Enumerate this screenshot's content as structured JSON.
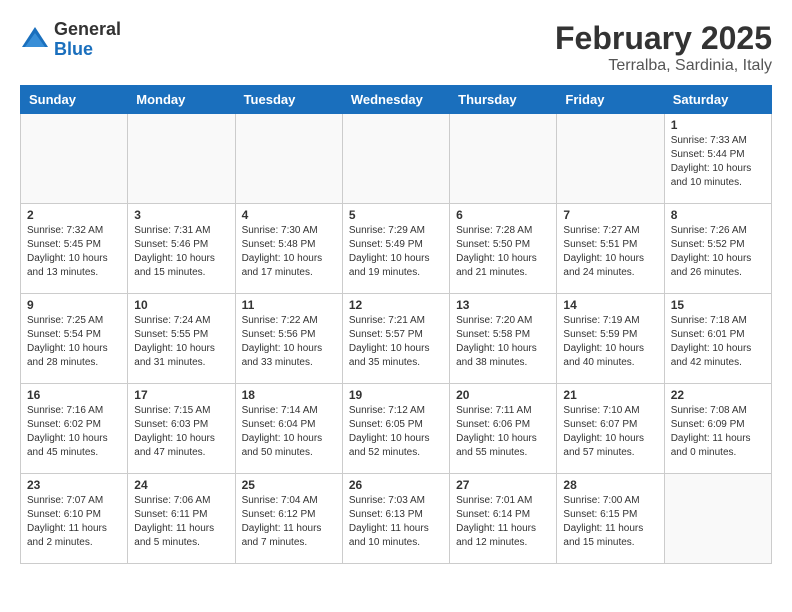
{
  "header": {
    "logo_general": "General",
    "logo_blue": "Blue",
    "title": "February 2025",
    "subtitle": "Terralba, Sardinia, Italy"
  },
  "weekdays": [
    "Sunday",
    "Monday",
    "Tuesday",
    "Wednesday",
    "Thursday",
    "Friday",
    "Saturday"
  ],
  "weeks": [
    [
      {
        "day": "",
        "info": ""
      },
      {
        "day": "",
        "info": ""
      },
      {
        "day": "",
        "info": ""
      },
      {
        "day": "",
        "info": ""
      },
      {
        "day": "",
        "info": ""
      },
      {
        "day": "",
        "info": ""
      },
      {
        "day": "1",
        "info": "Sunrise: 7:33 AM\nSunset: 5:44 PM\nDaylight: 10 hours\nand 10 minutes."
      }
    ],
    [
      {
        "day": "2",
        "info": "Sunrise: 7:32 AM\nSunset: 5:45 PM\nDaylight: 10 hours\nand 13 minutes."
      },
      {
        "day": "3",
        "info": "Sunrise: 7:31 AM\nSunset: 5:46 PM\nDaylight: 10 hours\nand 15 minutes."
      },
      {
        "day": "4",
        "info": "Sunrise: 7:30 AM\nSunset: 5:48 PM\nDaylight: 10 hours\nand 17 minutes."
      },
      {
        "day": "5",
        "info": "Sunrise: 7:29 AM\nSunset: 5:49 PM\nDaylight: 10 hours\nand 19 minutes."
      },
      {
        "day": "6",
        "info": "Sunrise: 7:28 AM\nSunset: 5:50 PM\nDaylight: 10 hours\nand 21 minutes."
      },
      {
        "day": "7",
        "info": "Sunrise: 7:27 AM\nSunset: 5:51 PM\nDaylight: 10 hours\nand 24 minutes."
      },
      {
        "day": "8",
        "info": "Sunrise: 7:26 AM\nSunset: 5:52 PM\nDaylight: 10 hours\nand 26 minutes."
      }
    ],
    [
      {
        "day": "9",
        "info": "Sunrise: 7:25 AM\nSunset: 5:54 PM\nDaylight: 10 hours\nand 28 minutes."
      },
      {
        "day": "10",
        "info": "Sunrise: 7:24 AM\nSunset: 5:55 PM\nDaylight: 10 hours\nand 31 minutes."
      },
      {
        "day": "11",
        "info": "Sunrise: 7:22 AM\nSunset: 5:56 PM\nDaylight: 10 hours\nand 33 minutes."
      },
      {
        "day": "12",
        "info": "Sunrise: 7:21 AM\nSunset: 5:57 PM\nDaylight: 10 hours\nand 35 minutes."
      },
      {
        "day": "13",
        "info": "Sunrise: 7:20 AM\nSunset: 5:58 PM\nDaylight: 10 hours\nand 38 minutes."
      },
      {
        "day": "14",
        "info": "Sunrise: 7:19 AM\nSunset: 5:59 PM\nDaylight: 10 hours\nand 40 minutes."
      },
      {
        "day": "15",
        "info": "Sunrise: 7:18 AM\nSunset: 6:01 PM\nDaylight: 10 hours\nand 42 minutes."
      }
    ],
    [
      {
        "day": "16",
        "info": "Sunrise: 7:16 AM\nSunset: 6:02 PM\nDaylight: 10 hours\nand 45 minutes."
      },
      {
        "day": "17",
        "info": "Sunrise: 7:15 AM\nSunset: 6:03 PM\nDaylight: 10 hours\nand 47 minutes."
      },
      {
        "day": "18",
        "info": "Sunrise: 7:14 AM\nSunset: 6:04 PM\nDaylight: 10 hours\nand 50 minutes."
      },
      {
        "day": "19",
        "info": "Sunrise: 7:12 AM\nSunset: 6:05 PM\nDaylight: 10 hours\nand 52 minutes."
      },
      {
        "day": "20",
        "info": "Sunrise: 7:11 AM\nSunset: 6:06 PM\nDaylight: 10 hours\nand 55 minutes."
      },
      {
        "day": "21",
        "info": "Sunrise: 7:10 AM\nSunset: 6:07 PM\nDaylight: 10 hours\nand 57 minutes."
      },
      {
        "day": "22",
        "info": "Sunrise: 7:08 AM\nSunset: 6:09 PM\nDaylight: 11 hours\nand 0 minutes."
      }
    ],
    [
      {
        "day": "23",
        "info": "Sunrise: 7:07 AM\nSunset: 6:10 PM\nDaylight: 11 hours\nand 2 minutes."
      },
      {
        "day": "24",
        "info": "Sunrise: 7:06 AM\nSunset: 6:11 PM\nDaylight: 11 hours\nand 5 minutes."
      },
      {
        "day": "25",
        "info": "Sunrise: 7:04 AM\nSunset: 6:12 PM\nDaylight: 11 hours\nand 7 minutes."
      },
      {
        "day": "26",
        "info": "Sunrise: 7:03 AM\nSunset: 6:13 PM\nDaylight: 11 hours\nand 10 minutes."
      },
      {
        "day": "27",
        "info": "Sunrise: 7:01 AM\nSunset: 6:14 PM\nDaylight: 11 hours\nand 12 minutes."
      },
      {
        "day": "28",
        "info": "Sunrise: 7:00 AM\nSunset: 6:15 PM\nDaylight: 11 hours\nand 15 minutes."
      },
      {
        "day": "",
        "info": ""
      }
    ]
  ]
}
